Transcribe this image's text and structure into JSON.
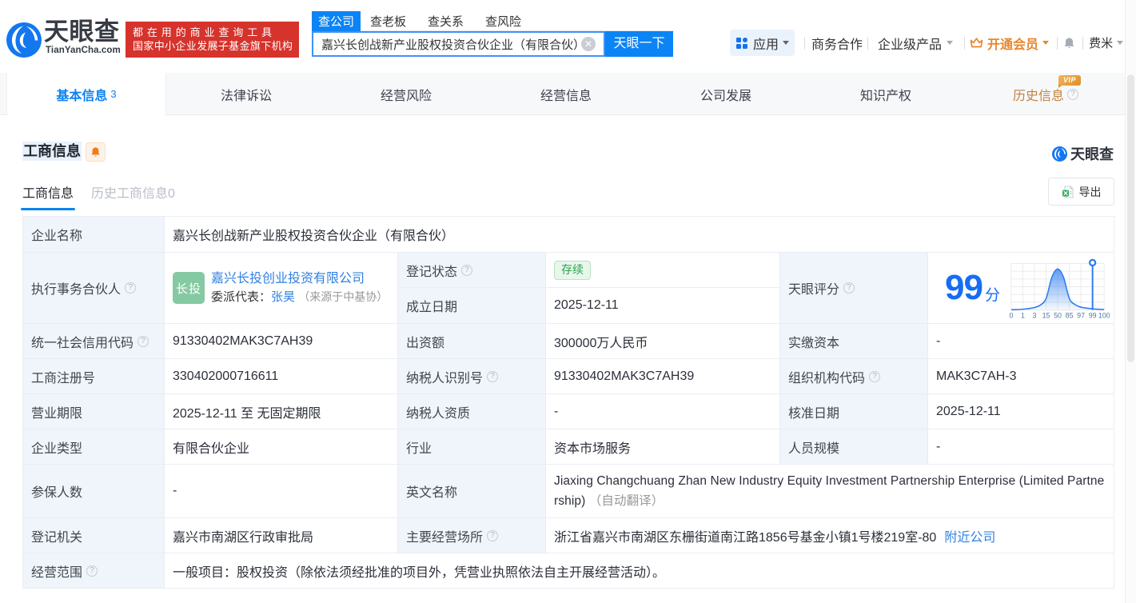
{
  "brand": {
    "name": "天眼查",
    "domain": "TianYanCha.com",
    "slogan_line1": "都在用的商业查询工具",
    "slogan_line2": "国家中小企业发展子基金旗下机构"
  },
  "search": {
    "tabs": [
      "查公司",
      "查老板",
      "查关系",
      "查风险"
    ],
    "active_tab": "查公司",
    "query": "嘉兴长创战新产业股权投资合伙企业（有限合伙）",
    "button": "天眼一下"
  },
  "top_menu": {
    "apps": "应用",
    "business_coop": "商务合作",
    "enterprise_product": "企业级产品",
    "vip": "开通会员",
    "user": "费米"
  },
  "nav": {
    "tabs": [
      {
        "label": "基本信息",
        "count": "3"
      },
      {
        "label": "法律诉讼"
      },
      {
        "label": "经营风险"
      },
      {
        "label": "经营信息"
      },
      {
        "label": "公司发展"
      },
      {
        "label": "知识产权"
      },
      {
        "label": "历史信息",
        "vip": "VIP"
      }
    ]
  },
  "section": {
    "title": "工商信息",
    "watermark": "天眼查",
    "tab_current": "工商信息",
    "tab_history": "历史工商信息0",
    "export_label": "导出"
  },
  "table": {
    "company_name_label": "企业名称",
    "company_name": "嘉兴长创战新产业股权投资合伙企业（有限合伙）",
    "partner_label": "执行事务合伙人",
    "partner_avatar": "长投",
    "partner_name": "嘉兴长投创业投资有限公司",
    "deputy_label": "委派代表：",
    "deputy_name": "张昊",
    "deputy_source": "（来源于中基协）",
    "reg_status_label": "登记状态",
    "reg_status": "存续",
    "establish_date_label": "成立日期",
    "establish_date": "2025-12-11",
    "score_label": "天眼评分",
    "score_value": "99",
    "score_unit": "分",
    "credit_code_label": "统一社会信用代码",
    "credit_code": "91330402MAK3C7AH39",
    "capital_label": "出资额",
    "capital": "300000万人民币",
    "paid_capital_label": "实缴资本",
    "paid_capital": "-",
    "reg_number_label": "工商注册号",
    "reg_number": "330402000716611",
    "taxpayer_id_label": "纳税人识别号",
    "taxpayer_id": "91330402MAK3C7AH39",
    "org_code_label": "组织机构代码",
    "org_code": "MAK3C7AH-3",
    "business_term_label": "营业期限",
    "business_term": "2025-12-11 至 无固定期限",
    "taxpayer_quality_label": "纳税人资质",
    "taxpayer_quality": "-",
    "approval_date_label": "核准日期",
    "approval_date": "2025-12-11",
    "company_type_label": "企业类型",
    "company_type": "有限合伙企业",
    "industry_label": "行业",
    "industry": "资本市场服务",
    "staff_size_label": "人员规模",
    "staff_size": "-",
    "insured_label": "参保人数",
    "insured": "-",
    "english_name_label": "英文名称",
    "english_name": "Jiaxing Changchuang Zhan New Industry Equity Investment Partnership Enterprise (Limited Partnership)",
    "english_name_note": "（自动翻译）",
    "reg_authority_label": "登记机关",
    "reg_authority": "嘉兴市南湖区行政审批局",
    "address_label": "主要经营场所",
    "address": "浙江省嘉兴市南湖区东栅街道南江路1856号基金小镇1号楼219室-80",
    "nearby_link": "附近公司",
    "business_scope_label": "经营范围",
    "business_scope": "一般项目：股权投资（除依法须经批准的项目外，凭营业执照依法自主开展经营活动）。"
  },
  "chart_data": {
    "type": "area",
    "title": "天眼评分分布曲线",
    "x_tick_labels": [
      "0",
      "1",
      "3",
      "15",
      "50",
      "85",
      "97",
      "99",
      "100"
    ],
    "curve_samples_x": [
      0,
      0.5,
      1,
      1.5,
      2,
      2.5,
      3,
      3.5,
      4,
      4.5,
      5,
      5.5,
      6,
      6.5,
      7,
      7.5,
      8
    ],
    "curve_samples_y": [
      0.005,
      0.01,
      0.02,
      0.035,
      0.06,
      0.12,
      0.28,
      0.8,
      1.0,
      0.8,
      0.28,
      0.13,
      0.07,
      0.045,
      0.028,
      0.018,
      0.012
    ],
    "marker_tick": "99",
    "score": 99,
    "ylim": [
      0,
      1
    ],
    "grid": true,
    "accent_color": "#2e7cf0"
  }
}
